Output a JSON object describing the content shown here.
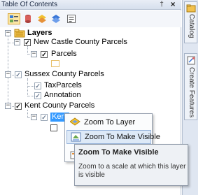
{
  "panel": {
    "title": "Table Of Contents",
    "pin_glyph": "†",
    "close_glyph": "×"
  },
  "tree": {
    "root": {
      "label": "Layers",
      "expanded": true
    },
    "groups": [
      {
        "label": "New Castle County Parcels",
        "checked": true,
        "children": [
          {
            "label": "Parcels",
            "checked": true
          }
        ]
      },
      {
        "label": "Sussex County Parcels",
        "checked": true,
        "dimmed": true,
        "children": [
          {
            "label": "TaxParcels",
            "checked": true
          },
          {
            "label": "Annotation",
            "checked": true
          }
        ]
      },
      {
        "label": "Kent County Parcels",
        "checked": true,
        "children": [
          {
            "label": "Kent",
            "checked": true,
            "selected": true
          }
        ]
      }
    ]
  },
  "dock": {
    "tabs": [
      {
        "label": "Catalog"
      },
      {
        "label": "Create Features"
      }
    ]
  },
  "context_menu": {
    "items": [
      {
        "label": "Zoom To Layer",
        "icon": "zoom-to-layer-icon",
        "highlighted": false
      },
      {
        "label": "Zoom To Make Visible",
        "icon": "zoom-to-make-visible-icon",
        "highlighted": true
      }
    ]
  },
  "tooltip": {
    "title": "Zoom To Make Visible",
    "body": "Zoom to a scale at which this layer is visible"
  },
  "colors": {
    "selection": "#3399ff",
    "menu_highlight": "#dde9f7",
    "active_tool": "#fbe7a6",
    "layer_folder": "#f2c14e"
  }
}
